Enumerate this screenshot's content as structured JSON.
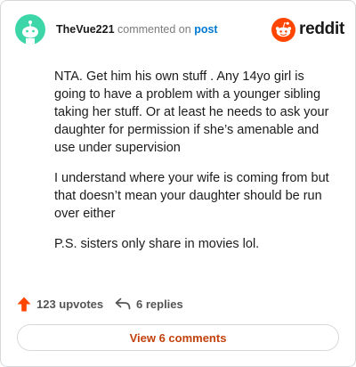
{
  "header": {
    "username": "TheVue221",
    "commented_on_text": "commented on",
    "post_link": "post",
    "brand": "reddit"
  },
  "comment": {
    "paragraphs": [
      "NTA. Get him his own stuff . Any 14yo girl is going to have a problem with a younger sibling taking her stuff. Or at least he needs to ask your daughter for permission if she’s amenable and use under supervision",
      "I understand where your wife is coming from but that doesn’t mean your daughter should be run over either",
      "P.S. sisters only share in movies lol."
    ]
  },
  "footer": {
    "upvotes": "123 upvotes",
    "replies": "6 replies",
    "view_comments": "View 6 comments"
  },
  "colors": {
    "avatar_bg": "#3dd6a8",
    "reddit_orange": "#ff4500",
    "link_blue": "#0079d3",
    "button_text": "#c2410c"
  },
  "icons": [
    "snoo-avatar-icon",
    "reddit-logo-icon",
    "upvote-arrow-icon",
    "reply-arrow-icon"
  ]
}
